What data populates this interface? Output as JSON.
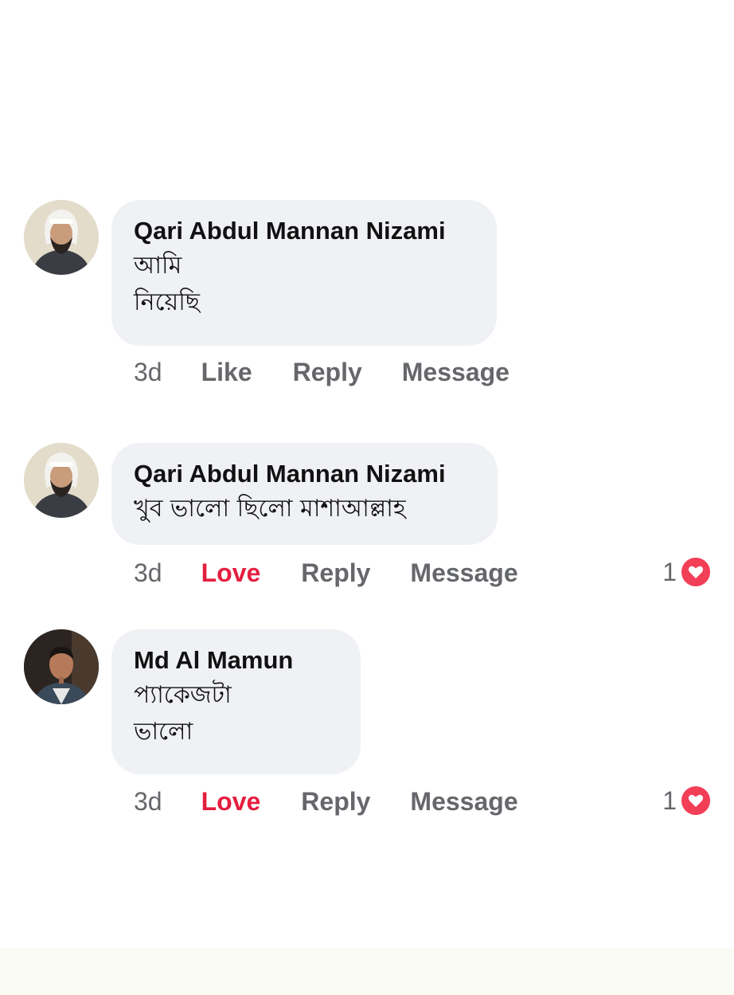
{
  "comments": [
    {
      "author": "Qari Abdul Mannan Nizami",
      "lines": [
        "আমি",
        "নিয়েছি"
      ],
      "time": "3d",
      "reaction_label": "Like",
      "reply_label": "Reply",
      "message_label": "Message",
      "reaction_count": ""
    },
    {
      "author": "Qari Abdul Mannan Nizami",
      "lines": [
        "খুব ভালো ছিলো মাশাআল্লাহ"
      ],
      "time": "3d",
      "reaction_label": "Love",
      "reply_label": "Reply",
      "message_label": "Message",
      "reaction_count": "1"
    },
    {
      "author": "Md Al Mamun",
      "lines": [
        "প্যাকেজটা",
        "ভালো"
      ],
      "time": "3d",
      "reaction_label": "Love",
      "reply_label": "Reply",
      "message_label": "Message",
      "reaction_count": "1"
    }
  ],
  "colors": {
    "bubble": "#f0f1f5",
    "love": "#e41e3f",
    "muted": "#65676b",
    "heart_badge": "#f33e58"
  },
  "icons": {
    "reaction_badge": "heart-icon"
  }
}
